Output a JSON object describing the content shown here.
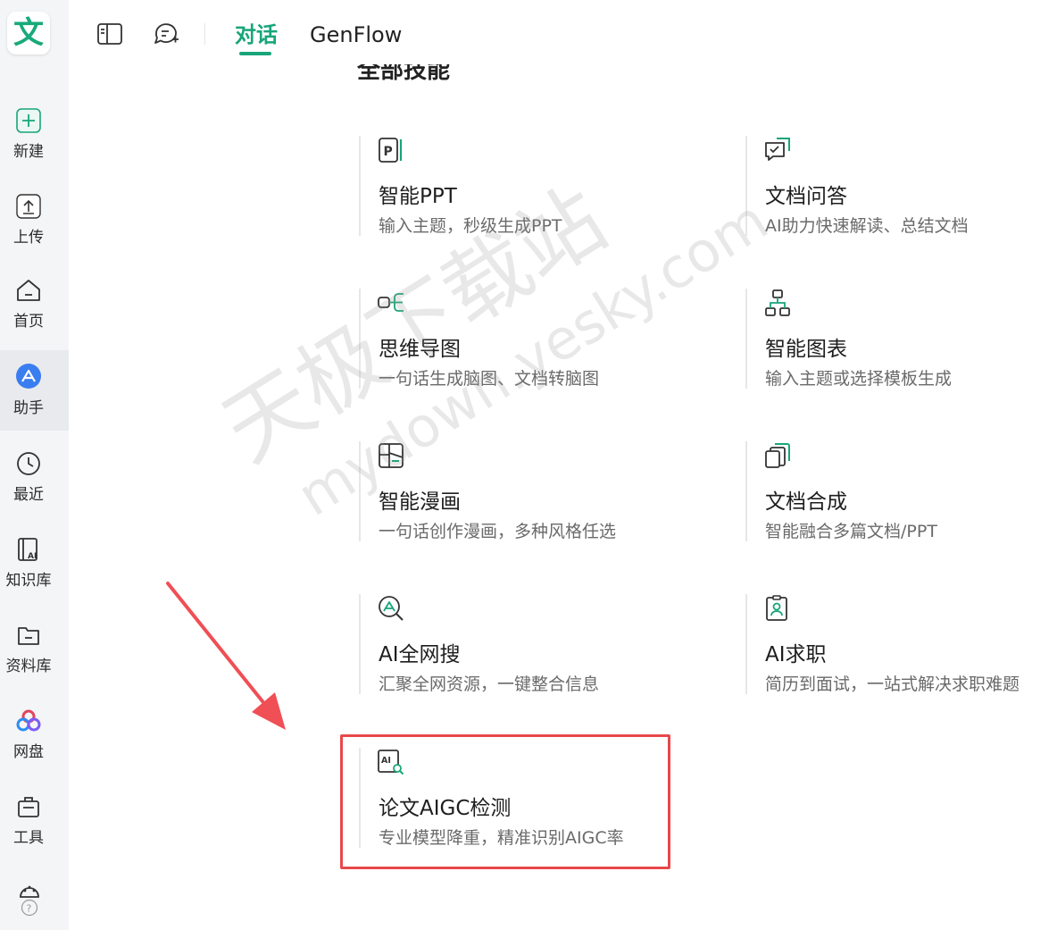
{
  "app": {
    "logo_char": "文",
    "accent": "#18a57a",
    "highlight_color": "#e8484b"
  },
  "sidebar": {
    "items": [
      {
        "label": "新建",
        "icon": "plus-icon"
      },
      {
        "label": "上传",
        "icon": "upload-icon"
      },
      {
        "label": "首页",
        "icon": "home-icon"
      },
      {
        "label": "助手",
        "icon": "assistant-icon",
        "active": true
      },
      {
        "label": "最近",
        "icon": "clock-icon"
      },
      {
        "label": "知识库",
        "icon": "knowledge-base-icon"
      },
      {
        "label": "资料库",
        "icon": "folder-icon"
      },
      {
        "label": "网盘",
        "icon": "cloud-drive-icon"
      },
      {
        "label": "工具",
        "icon": "toolbox-icon"
      }
    ],
    "bottom_icon": "palette-icon",
    "help_icon": "help-icon"
  },
  "header": {
    "icons": [
      "sidebar-toggle-icon",
      "new-chat-icon"
    ],
    "tabs": [
      {
        "label": "对话",
        "active": true
      },
      {
        "label": "GenFlow",
        "active": false
      }
    ]
  },
  "main": {
    "section_title": "全部技能",
    "cards": [
      {
        "icon": "ppt-icon",
        "title": "智能PPT",
        "desc": "输入主题，秒级生成PPT"
      },
      {
        "icon": "doc-qa-icon",
        "title": "文档问答",
        "desc": "AI助力快速解读、总结文档"
      },
      {
        "icon": "mindmap-icon",
        "title": "思维导图",
        "desc": "一句话生成脑图、文档转脑图"
      },
      {
        "icon": "org-chart-icon",
        "title": "智能图表",
        "desc": "输入主题或选择模板生成"
      },
      {
        "icon": "comic-icon",
        "title": "智能漫画",
        "desc": "一句话创作漫画，多种风格任选"
      },
      {
        "icon": "doc-merge-icon",
        "title": "文档合成",
        "desc": "智能融合多篇文档/PPT"
      },
      {
        "icon": "ai-search-icon",
        "title": "AI全网搜",
        "desc": "汇聚全网资源，一键整合信息"
      },
      {
        "icon": "job-icon",
        "title": "AI求职",
        "desc": "简历到面试，一站式解决求职难题"
      },
      {
        "icon": "aigc-detect-icon",
        "title": "论文AIGC检测",
        "desc": "专业模型降重，精准识别AIGC率",
        "highlighted": true
      }
    ]
  },
  "watermark": {
    "line1": "天极下载站",
    "line2": "mydown.yesky.com"
  }
}
